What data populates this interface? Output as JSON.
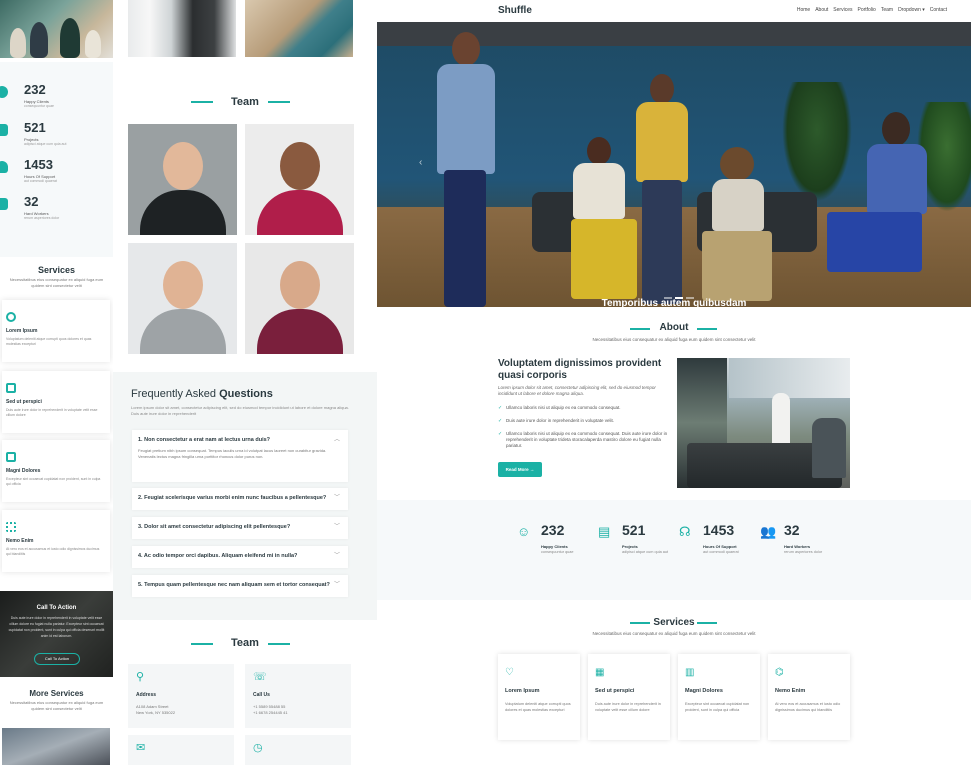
{
  "nav": {
    "logo": "Shuffle",
    "menu": [
      "Home",
      "About",
      "Services",
      "Portfolio",
      "Team",
      "Dropdown ▾",
      "Contact"
    ]
  },
  "hero": {
    "caption": "Temporibus autem quibusdam",
    "slide_index": 2,
    "slide_count": 3
  },
  "about": {
    "title": "About",
    "subtitle": "Necessitatibus eius consequatur ex aliquid fuga eum quidem sint consectetur velit",
    "heading": "Voluptatem dignissimos provident quasi corporis",
    "intro": "Lorem ipsum dolor sit amet, consectetur adipiscing elit, sed do eiusmod tempor incididunt ut labore et dolore magna aliqua.",
    "checks": [
      "Ullamco laboris nisi ut aliquip ex ea commodo consequat.",
      "Duis aute irure dolor in reprehenderit in voluptate velit.",
      "Ullamco laboris nisi ut aliquip ex ea commodo consequat. Duis aute irure dolor in reprehenderit in voluptate trideta storacalaperda mastiro dolore eu fugiat nulla pariatur."
    ],
    "button": "Read More →"
  },
  "stats": [
    {
      "icon": "smile-icon",
      "glyph": "☺",
      "number": "232",
      "label": "Happy Clients",
      "sub": "consequuntur quae"
    },
    {
      "icon": "journal-icon",
      "glyph": "▤",
      "number": "521",
      "label": "Projects",
      "sub": "adipisci atque cum quia aut"
    },
    {
      "icon": "headset-icon",
      "glyph": "☊",
      "number": "1453",
      "label": "Hours Of Support",
      "sub": "aut commodi quaerat"
    },
    {
      "icon": "people-icon",
      "glyph": "👥",
      "number": "32",
      "label": "Hard Workers",
      "sub": "rerum asperiores dolor"
    }
  ],
  "services": {
    "title": "Services",
    "subtitle": "Necessitatibus eius consequatur ex aliquid fuga eum quidem sint consectetur velit",
    "cards": [
      {
        "icon": "heart-pulse-icon",
        "glyph": "♡",
        "title": "Lorem Ipsum",
        "desc": "Voluptatum deleniti atque corrupti quos dolores et quas molestias excepturi"
      },
      {
        "icon": "grid-icon",
        "glyph": "▦",
        "title": "Sed ut perspici",
        "desc": "Duis aute irure dolor in reprehenderit in voluptate velit esse cillum dolore"
      },
      {
        "icon": "calendar-icon",
        "glyph": "▥",
        "title": "Magni Dolores",
        "desc": "Excepteur sint occaecat cupidatat non proident, sunt in culpa qui officia"
      },
      {
        "icon": "broadcast-icon",
        "glyph": "⌬",
        "title": "Nemo Enim",
        "desc": "At vero eos et accusamus et iusto odio dignissimos ducimus qui blanditiis"
      }
    ]
  },
  "left_column": {
    "stats": [
      {
        "number": "232",
        "label": "Happy Clients",
        "sub": "consequuntur quae"
      },
      {
        "number": "521",
        "label": "Projects",
        "sub": "adipisci atque cum quia aut"
      },
      {
        "number": "1453",
        "label": "Hours Of Support",
        "sub": "aut commodi quaerat"
      },
      {
        "number": "32",
        "label": "Hard Workers",
        "sub": "rerum asperiores dolor"
      }
    ],
    "services_title": "Services",
    "services_sub": "Necessitatibus eius consequatur ex aliquid fuga eum quidem sint consectetur velit",
    "service_cards": [
      {
        "title": "Lorem Ipsum",
        "desc": "Voluptatum deleniti atque corrupti quos dolores et quas molestias excepturi"
      },
      {
        "title": "Sed ut perspici",
        "desc": "Duis aute irure dolor in reprehenderit in voluptate velit esse cillum dolore"
      },
      {
        "title": "Magni Dolores",
        "desc": "Excepteur sint occaecat cupidatat non proident, sunt in culpa qui officia"
      },
      {
        "title": "Nemo Enim",
        "desc": "At vero eos et accusamus et iusto odio dignissimos ducimus qui blanditiis"
      }
    ],
    "cta_title": "Call To Action",
    "cta_desc": "Duis aute irure dolor in reprehenderit in voluptate velit esse cillum dolore eu fugiat nulla pariatur. Excepteur sint occaecat cupidatat non proident, sunt in culpa qui officia deserunt mollit anim id est laborum.",
    "cta_button": "Call To Action",
    "more_services_title": "More Services",
    "more_services_sub": "Necessitatibus eius consequatur ex aliquid fuga eum quidem sint consectetur velit"
  },
  "middle_column": {
    "team_title": "Team",
    "faq_title_light": "Frequently Asked ",
    "faq_title_bold": "Questions",
    "faq_desc": "Lorem ipsum dolor sit amet, consectetur adipiscing elit, sed do eiusmod tempor incididunt ut labore et dolore magna aliqua. Duis aute irure dolor in reprehenderit",
    "faqs": [
      {
        "q": "1. Non consectetur a erat nam at lectus urna duis?",
        "a": "Feugiat pretium nibh ipsum consequat. Tempus iaculis urna id volutpat lacus laoreet non curabitur gravida. Venenatis lectus magna fringilla urna porttitor rhoncus dolor purus non.",
        "open": true
      },
      {
        "q": "2. Feugiat scelerisque varius morbi enim nunc faucibus a pellentesque?",
        "open": false
      },
      {
        "q": "3. Dolor sit amet consectetur adipiscing elit pellentesque?",
        "open": false
      },
      {
        "q": "4. Ac odio tempor orci dapibus. Aliquam eleifend mi in nulla?",
        "open": false
      },
      {
        "q": "5. Tempus quam pellentesque nec nam aliquam sem et tortor consequat?",
        "open": false
      }
    ],
    "team_title_2": "Team",
    "contacts": [
      {
        "icon": "map-pin-icon",
        "glyph": "⚲",
        "title": "Address",
        "lines": [
          "A108 Adam Street",
          "New York, NY 535022"
        ]
      },
      {
        "icon": "phone-icon",
        "glyph": "☏",
        "title": "Call Us",
        "lines": [
          "+1 5589 55488 55",
          "+1 6678 254445 41"
        ]
      },
      {
        "icon": "envelope-icon",
        "glyph": "✉",
        "title": "",
        "lines": []
      },
      {
        "icon": "clock-icon",
        "glyph": "◷",
        "title": "",
        "lines": []
      }
    ]
  },
  "colors": {
    "accent": "#1bb1a5",
    "dark_text": "#2b3a40",
    "light_bg": "#f6f9fa"
  }
}
